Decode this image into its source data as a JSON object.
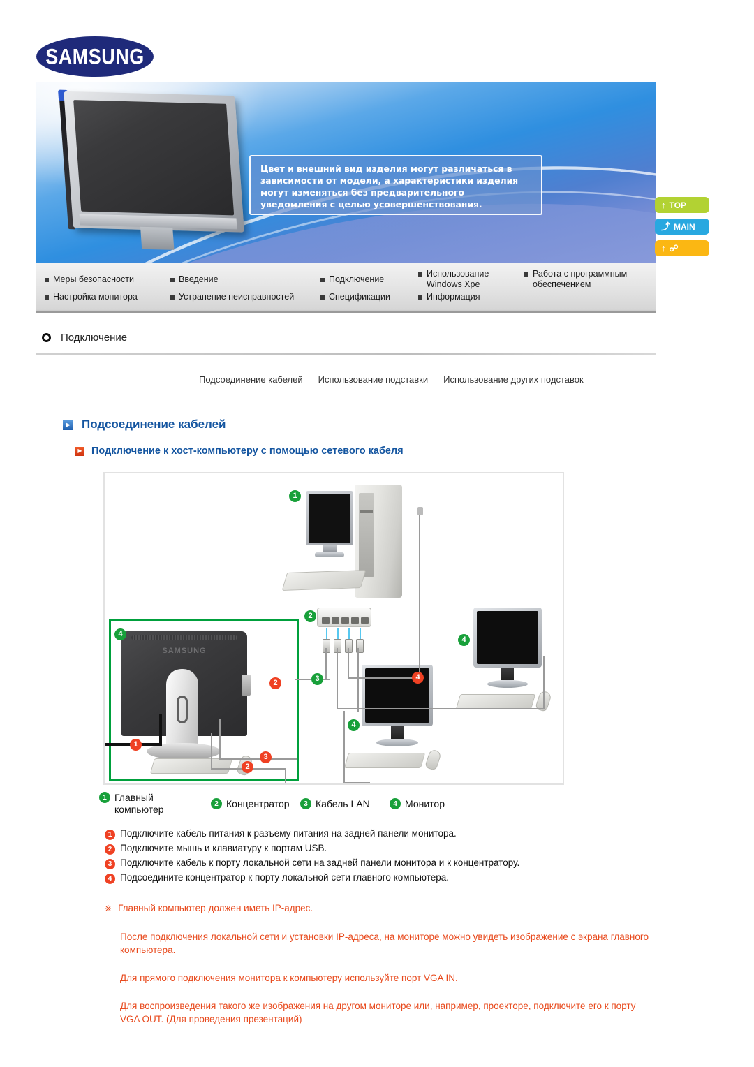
{
  "brand": {
    "logo_text": "SAMSUNG"
  },
  "banner": {
    "callout_text": "Цвет и внешний вид изделия могут различаться в зависимости от модели, а характеристики изделия могут изменяться без предварительного уведомления с целью усовершенствования."
  },
  "side_buttons": [
    {
      "label": "TOP",
      "icon": "arrow-up-icon",
      "color": "#b2d233"
    },
    {
      "label": "MAIN",
      "icon": "arrow-branch-icon",
      "color": "#28a8e0"
    },
    {
      "label": "",
      "icon": "arrow-up-book-icon",
      "color": "#fbb713"
    }
  ],
  "nav": {
    "row1": [
      {
        "label": "Меры безопасности"
      },
      {
        "label": "Введение"
      },
      {
        "label": "Подключение"
      },
      {
        "label": "Использование\nWindows Xpe"
      },
      {
        "label": "Работа с программным\nобеспечением"
      }
    ],
    "row2": [
      {
        "label": "Настройка монитора"
      },
      {
        "label": "Устранение неисправностей"
      },
      {
        "label": "Спецификации"
      },
      {
        "label": "Информация"
      }
    ]
  },
  "breadcrumb": {
    "icon": "circle-icon",
    "label": "Подключение"
  },
  "subtabs": [
    {
      "label": "Подсоединение кабелей"
    },
    {
      "label": "Использование подставки"
    },
    {
      "label": "Использование других подставок"
    }
  ],
  "headings": {
    "h1": "Подсоединение кабелей",
    "h2": "Подключение к хост-компьютеру с помощью сетевого кабеля"
  },
  "diagram": {
    "badges": [
      {
        "n": "1",
        "color": "green"
      },
      {
        "n": "2",
        "color": "green"
      },
      {
        "n": "3",
        "color": "green"
      },
      {
        "n": "4",
        "color": "green"
      },
      {
        "n": "1",
        "color": "orange"
      },
      {
        "n": "2",
        "color": "orange"
      },
      {
        "n": "3",
        "color": "orange"
      },
      {
        "n": "4",
        "color": "orange"
      }
    ],
    "monitor_watermark": "SAMSUNG"
  },
  "legend": [
    {
      "n": "1",
      "label": "Главный\nкомпьютер"
    },
    {
      "n": "2",
      "label": "Концентратор"
    },
    {
      "n": "3",
      "label": "Кабель LAN"
    },
    {
      "n": "4",
      "label": "Монитор"
    }
  ],
  "steps": [
    {
      "n": "1",
      "text": "Подключите кабель питания к разъему питания на задней панели монитора."
    },
    {
      "n": "2",
      "text": "Подключите мышь и клавиатуру к портам USB."
    },
    {
      "n": "3",
      "text": "Подключите кабель к порту локальной сети на задней панели монитора и к концентратору."
    },
    {
      "n": "4",
      "text": "Подсоедините концентратор к порту локальной сети главного компьютера."
    }
  ],
  "notes": {
    "star_icon": "※",
    "first": "Главный компьютер должен иметь IP-адрес.",
    "paragraphs": [
      "После подключения локальной сети и установки IP-адреса, на мониторе можно увидеть изображение с экрана главного компьютера.",
      "Для прямого подключения монитора к компьютеру используйте порт VGA IN.",
      "Для воспроизведения такого же изображения на другом мониторе или, например, проекторе, подключите его к порту VGA OUT. (Для проведения презентаций)"
    ]
  }
}
